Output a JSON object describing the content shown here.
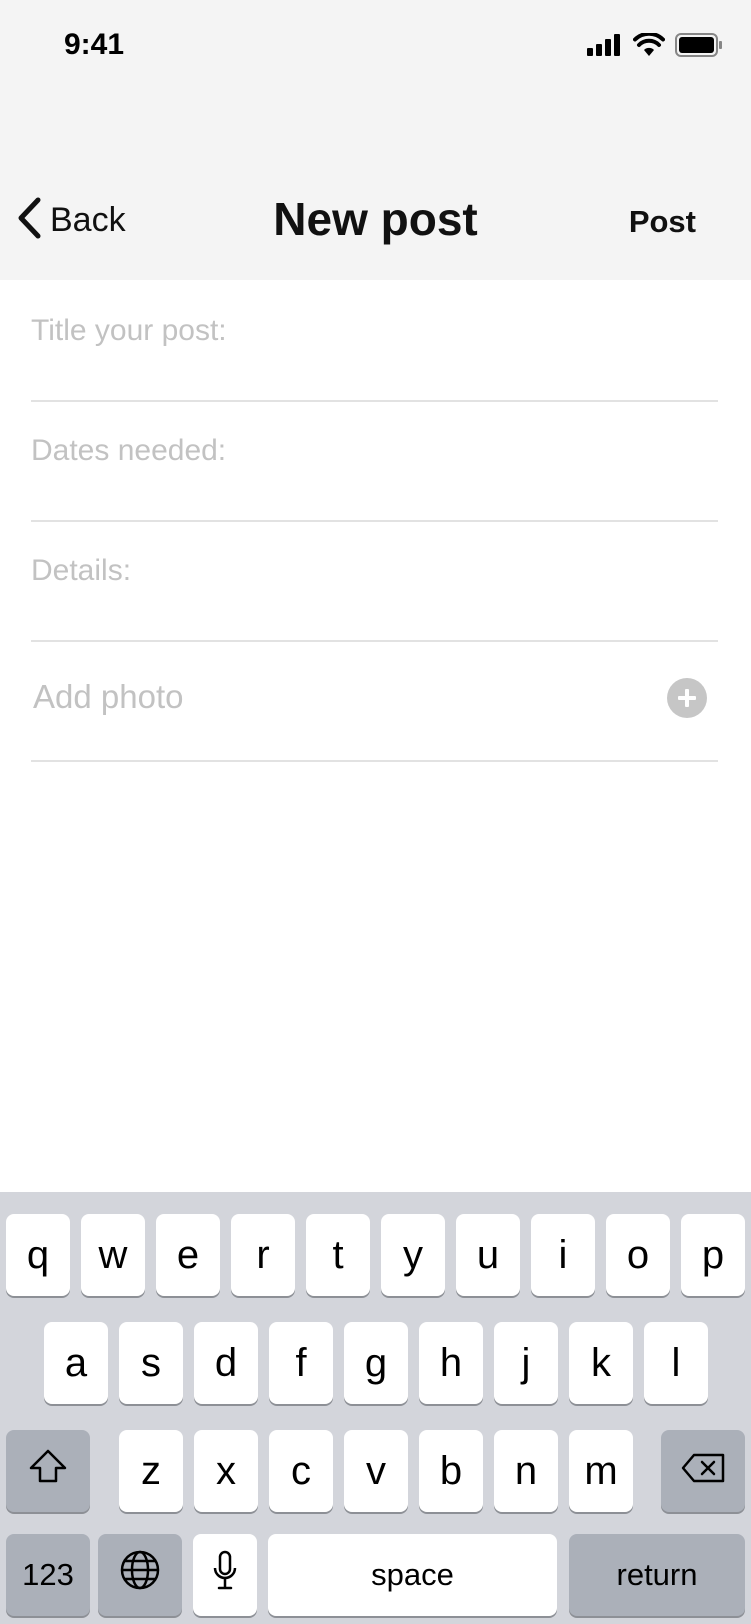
{
  "status_bar": {
    "time": "9:41"
  },
  "nav": {
    "back_label": "Back",
    "title": "New post",
    "post_label": "Post"
  },
  "form": {
    "title_placeholder": "Title your post:",
    "dates_placeholder": "Dates needed:",
    "details_placeholder": "Details:",
    "add_photo_label": "Add photo"
  },
  "keyboard": {
    "row1": [
      "q",
      "w",
      "e",
      "r",
      "t",
      "y",
      "u",
      "i",
      "o",
      "p"
    ],
    "row2": [
      "a",
      "s",
      "d",
      "f",
      "g",
      "h",
      "j",
      "k",
      "l"
    ],
    "row3": [
      "z",
      "x",
      "c",
      "v",
      "b",
      "n",
      "m"
    ],
    "numbers_key": "123",
    "space_key": "space",
    "return_key": "return"
  },
  "colors": {
    "header_bg": "#f4f4f4",
    "placeholder": "#c2c2c2",
    "keyboard_bg": "#d3d5db",
    "special_key": "#abb0b9"
  }
}
